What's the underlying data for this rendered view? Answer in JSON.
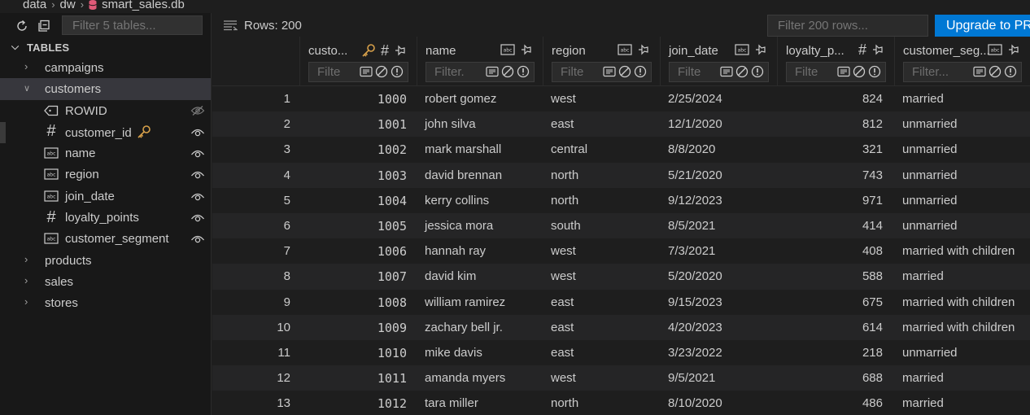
{
  "breadcrumb": {
    "parts": [
      "data",
      "dw",
      "smart_sales.db"
    ]
  },
  "sidebar": {
    "filter_placeholder": "Filter 5 tables...",
    "tables_header": "TABLES",
    "tables": [
      {
        "label": "campaigns",
        "expanded": false
      },
      {
        "label": "customers",
        "expanded": true
      },
      {
        "label": "products",
        "expanded": false
      },
      {
        "label": "sales",
        "expanded": false
      },
      {
        "label": "stores",
        "expanded": false
      }
    ],
    "columns": [
      {
        "label": "ROWID",
        "icon": "tag-icon",
        "visibility": "hidden"
      },
      {
        "label": "customer_id",
        "icon": "hash-icon",
        "visibility": "visible",
        "key": true
      },
      {
        "label": "name",
        "icon": "text-type-icon",
        "visibility": "visible"
      },
      {
        "label": "region",
        "icon": "text-type-icon",
        "visibility": "visible"
      },
      {
        "label": "join_date",
        "icon": "text-type-icon",
        "visibility": "visible"
      },
      {
        "label": "loyalty_points",
        "icon": "hash-icon",
        "visibility": "visible"
      },
      {
        "label": "customer_segment",
        "icon": "text-type-icon",
        "visibility": "visible"
      }
    ]
  },
  "toolbar": {
    "rows_label": "Rows: 200",
    "filter_placeholder": "Filter 200 rows...",
    "upgrade_label": "Upgrade to PRO"
  },
  "grid": {
    "columns": [
      {
        "title": "custo...",
        "type": "number",
        "key": true,
        "filter_placeholder": "Filte"
      },
      {
        "title": "name",
        "type": "text",
        "filter_placeholder": "Filter."
      },
      {
        "title": "region",
        "type": "text",
        "filter_placeholder": "Filte"
      },
      {
        "title": "join_date",
        "type": "text",
        "filter_placeholder": "Filte"
      },
      {
        "title": "loyalty_p...",
        "type": "number",
        "filter_placeholder": "Filte"
      },
      {
        "title": "customer_seg...",
        "type": "text",
        "filter_placeholder": "Filter..."
      }
    ],
    "rows": [
      [
        "1",
        "1000",
        "robert gomez",
        "west",
        "2/25/2024",
        "824",
        "married"
      ],
      [
        "2",
        "1001",
        "john silva",
        "east",
        "12/1/2020",
        "812",
        "unmarried"
      ],
      [
        "3",
        "1002",
        "mark marshall",
        "central",
        "8/8/2020",
        "321",
        "unmarried"
      ],
      [
        "4",
        "1003",
        "david brennan",
        "north",
        "5/21/2020",
        "743",
        "unmarried"
      ],
      [
        "5",
        "1004",
        "kerry collins",
        "north",
        "9/12/2023",
        "971",
        "unmarried"
      ],
      [
        "6",
        "1005",
        "jessica mora",
        "south",
        "8/5/2021",
        "414",
        "unmarried"
      ],
      [
        "7",
        "1006",
        "hannah ray",
        "west",
        "7/3/2021",
        "408",
        "married with children"
      ],
      [
        "8",
        "1007",
        "david kim",
        "west",
        "5/20/2020",
        "588",
        "married"
      ],
      [
        "9",
        "1008",
        "william ramirez",
        "east",
        "9/15/2023",
        "675",
        "married with children"
      ],
      [
        "10",
        "1009",
        "zachary bell jr.",
        "east",
        "4/20/2023",
        "614",
        "married with children"
      ],
      [
        "11",
        "1010",
        "mike davis",
        "east",
        "3/23/2022",
        "218",
        "unmarried"
      ],
      [
        "12",
        "1011",
        "amanda myers",
        "west",
        "9/5/2021",
        "688",
        "married"
      ],
      [
        "13",
        "1012",
        "tara miller",
        "north",
        "8/10/2020",
        "486",
        "married"
      ]
    ]
  },
  "colors": {
    "accent": "#0078d4",
    "key": "#d7a04a",
    "db_icon": "#e05a78"
  }
}
